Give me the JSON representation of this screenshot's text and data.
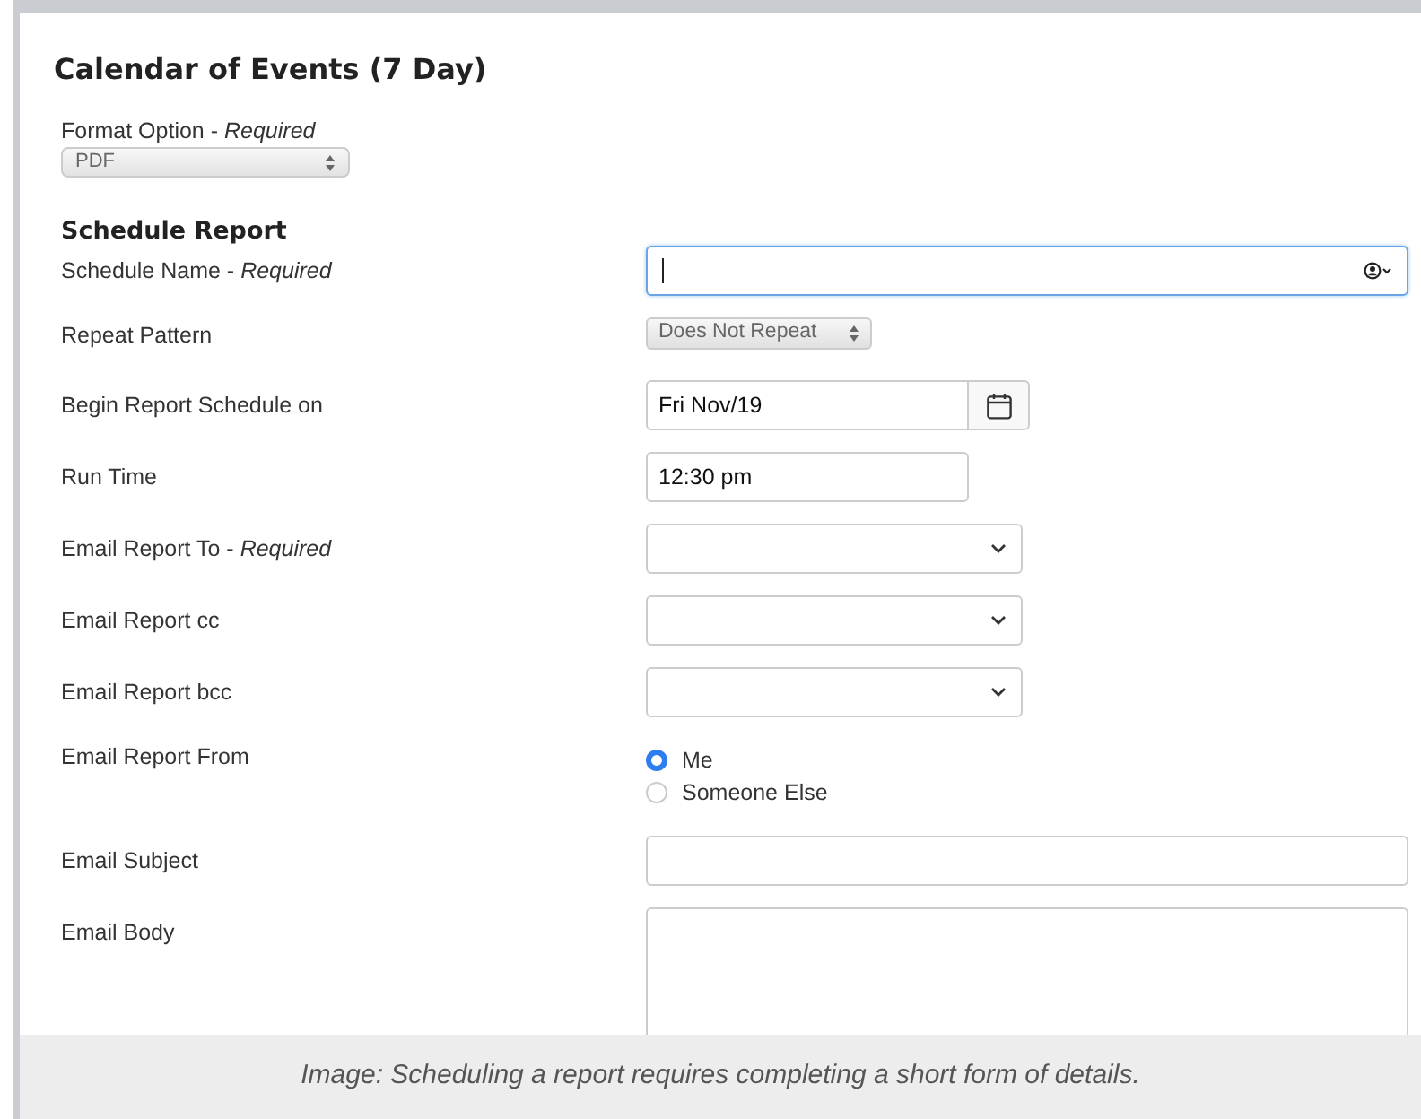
{
  "title": "Calendar of Events (7 Day)",
  "format_option": {
    "label": "Format Option - *Required*",
    "value": "PDF"
  },
  "section_heading": "Schedule Report",
  "rows": [
    {
      "kind": "person_field",
      "label": "Schedule Name - *Required*",
      "focused": true
    },
    {
      "kind": "stepper_select",
      "label": "Repeat Pattern",
      "value": "Does Not Repeat"
    },
    {
      "kind": "date",
      "label": "Begin Report Schedule on",
      "value": "Fri Nov/19"
    },
    {
      "kind": "text",
      "label": "Run Time",
      "value": "12:30 pm"
    },
    {
      "kind": "dropdown",
      "label": "Email Report To - *Required*"
    },
    {
      "kind": "dropdown",
      "label": "Email Report cc"
    },
    {
      "kind": "dropdown",
      "label": "Email Report bcc"
    },
    {
      "kind": "radio",
      "label": "Email Report From",
      "options": [
        {
          "label": "Me",
          "selected": true
        },
        {
          "label": "Someone Else",
          "selected": false
        }
      ]
    },
    {
      "kind": "wide_text",
      "label": "Email Subject"
    },
    {
      "kind": "textarea",
      "label": "Email Body"
    }
  ],
  "caption": "Image: Scheduling a report requires completing a short form of details."
}
